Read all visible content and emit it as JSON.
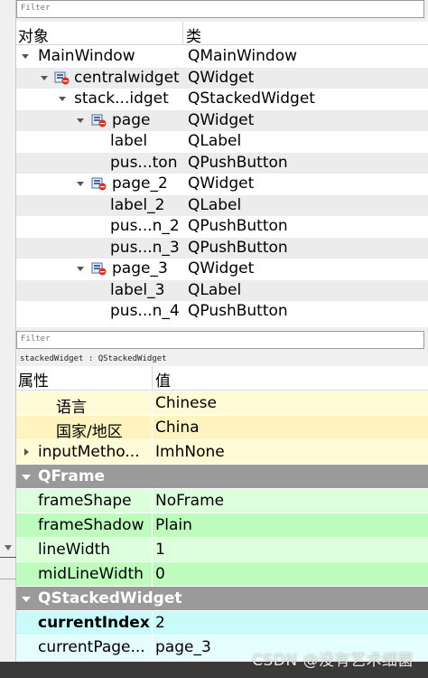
{
  "object_inspector": {
    "filter_placeholder": "Filter",
    "header": {
      "object": "对象",
      "class": "类"
    },
    "rows": [
      {
        "name": "MainWindow",
        "class": "QMainWindow"
      },
      {
        "name": "centralwidget",
        "class": "QWidget"
      },
      {
        "name": "stack...idget",
        "class": "QStackedWidget"
      },
      {
        "name": "page",
        "class": "QWidget"
      },
      {
        "name": "label",
        "class": "QLabel"
      },
      {
        "name": "pus...ton",
        "class": "QPushButton"
      },
      {
        "name": "page_2",
        "class": "QWidget"
      },
      {
        "name": "label_2",
        "class": "QLabel"
      },
      {
        "name": "pus...n_2",
        "class": "QPushButton"
      },
      {
        "name": "pus...n_3",
        "class": "QPushButton"
      },
      {
        "name": "page_3",
        "class": "QWidget"
      },
      {
        "name": "label_3",
        "class": "QLabel"
      },
      {
        "name": "pus...n_4",
        "class": "QPushButton"
      }
    ]
  },
  "property_editor": {
    "filter_placeholder": "Filter",
    "title": "stackedWidget : QStackedWidget",
    "header": {
      "property": "属性",
      "value": "值"
    },
    "rows": [
      {
        "name": "语言",
        "value": "Chinese"
      },
      {
        "name": "国家/地区",
        "value": "China"
      },
      {
        "name": "inputMetho...",
        "value": "ImhNone"
      },
      {
        "group": "QFrame"
      },
      {
        "name": "frameShape",
        "value": "NoFrame"
      },
      {
        "name": "frameShadow",
        "value": "Plain"
      },
      {
        "name": "lineWidth",
        "value": "1"
      },
      {
        "name": "midLineWidth",
        "value": "0"
      },
      {
        "group": "QStackedWidget"
      },
      {
        "name": "currentIndex",
        "value": "2"
      },
      {
        "name": "currentPage...",
        "value": "page_3"
      }
    ]
  },
  "watermark": "CSDN @没有艺术细菌",
  "colors": {
    "locale_rows": "#fffbd6",
    "qframe_group": "#9a9a9a",
    "qframe_rows_a": "#dcffdc",
    "qframe_rows_b": "#bdfcbd",
    "qstacked_group": "#9a9a9a",
    "qstacked_rows_a": "#c9fbfb",
    "qstacked_rows_b": "#e4fdfd"
  }
}
